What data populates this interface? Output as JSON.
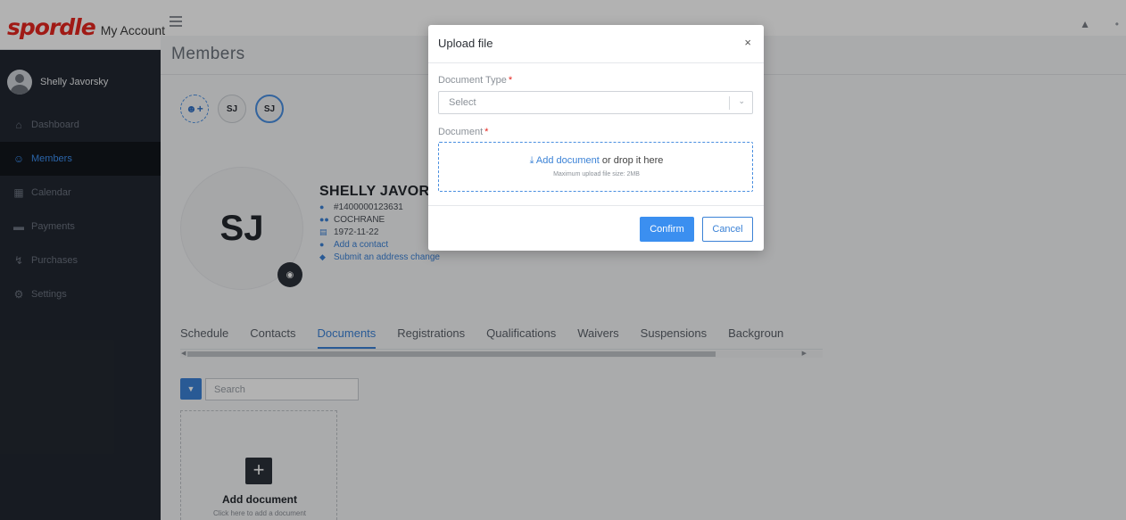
{
  "app": {
    "logo_word": "spordle",
    "logo_sub": "My Account"
  },
  "page": {
    "title": "Members"
  },
  "sidebar": {
    "user_name": "Shelly Javorsky",
    "items": [
      {
        "label": "Dashboard",
        "icon": "home-icon"
      },
      {
        "label": "Members",
        "icon": "user-icon",
        "active": true
      },
      {
        "label": "Calendar",
        "icon": "calendar-icon"
      },
      {
        "label": "Payments",
        "icon": "credit-card-icon"
      },
      {
        "label": "Purchases",
        "icon": "cart-icon"
      },
      {
        "label": "Settings",
        "icon": "gear-icon"
      }
    ]
  },
  "member": {
    "circles": [
      "SJ",
      "SJ"
    ],
    "initials": "SJ",
    "name": "SHELLY JAVOR",
    "member_number": "#1400000123631",
    "organization": "COCHRANE",
    "birthdate": "1972-11-22",
    "add_contact": "Add a contact",
    "address_change": "Submit an address change"
  },
  "tabs": [
    "Schedule",
    "Contacts",
    "Documents",
    "Registrations",
    "Qualifications",
    "Waivers",
    "Suspensions",
    "Backgroun"
  ],
  "active_tab": "Documents",
  "documents": {
    "search_placeholder": "Search",
    "add_title": "Add document",
    "add_sub": "Click here to add a document"
  },
  "modal": {
    "title": "Upload file",
    "close": "×",
    "doc_type_label": "Document Type",
    "required_mark": "*",
    "select_placeholder": "Select",
    "document_label": "Document",
    "add_document_link": "Add document",
    "drop_text": " or drop it here",
    "max_size": "Maximum upload file size: 2MB",
    "confirm": "Confirm",
    "cancel": "Cancel"
  },
  "colors": {
    "brand_red": "#e5261f",
    "accent_blue": "#3b82d6",
    "sidebar_bg": "#222831"
  }
}
